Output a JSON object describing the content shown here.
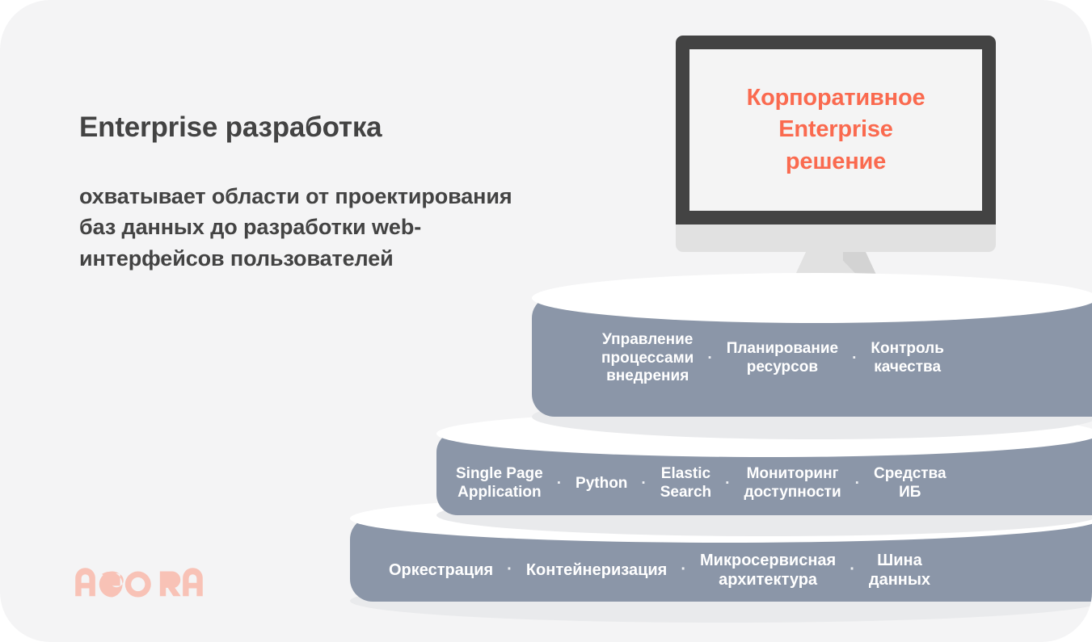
{
  "card": {
    "background": "#f4f4f5",
    "accent": "#fa6a4f",
    "step_color": "#8b96a8",
    "text_color": "#434343"
  },
  "headline": "Enterprise разработка",
  "subcopy": "охватывает области от проектирования баз данных до разработки web-интерфейсов пользователей",
  "monitor": {
    "screen_text_lines": [
      "Корпоративное",
      "Enterprise",
      "решение"
    ],
    "screen_text": "Корпоративное Enterprise решение",
    "bezel_color": "#434343",
    "body_color": "#e1e1e1",
    "screen_color": "#f4f4f4"
  },
  "separator": "·",
  "steps": [
    {
      "id": "top",
      "level": 3,
      "items": [
        "Управление процессами внедрения",
        "Планирование ресурсов",
        "Контроль качества"
      ],
      "item_lines": [
        [
          "Управление",
          "процессами",
          "внедрения"
        ],
        [
          "Планирование",
          "ресурсов"
        ],
        [
          "Контроль",
          "качества"
        ]
      ]
    },
    {
      "id": "middle",
      "level": 2,
      "items": [
        "Single Page Application",
        "Python",
        "Elastic Search",
        "Мониторинг доступности",
        "Средства ИБ"
      ],
      "item_lines": [
        [
          "Single Page",
          "Application"
        ],
        [
          "Python"
        ],
        [
          "Elastic",
          "Search"
        ],
        [
          "Мониторинг",
          "доступности"
        ],
        [
          "Средства",
          "ИБ"
        ]
      ]
    },
    {
      "id": "bottom",
      "level": 1,
      "items": [
        "Оркестрация",
        "Контейнеризация",
        "Микросервисная архитектура",
        "Шина данных"
      ],
      "item_lines": [
        [
          "Оркестрация"
        ],
        [
          "Контейнеризация"
        ],
        [
          "Микросервисная",
          "архитектура"
        ],
        [
          "Шина",
          "данных"
        ]
      ]
    }
  ],
  "logo": {
    "name": "AGORA",
    "color": "#f8c2b6"
  }
}
